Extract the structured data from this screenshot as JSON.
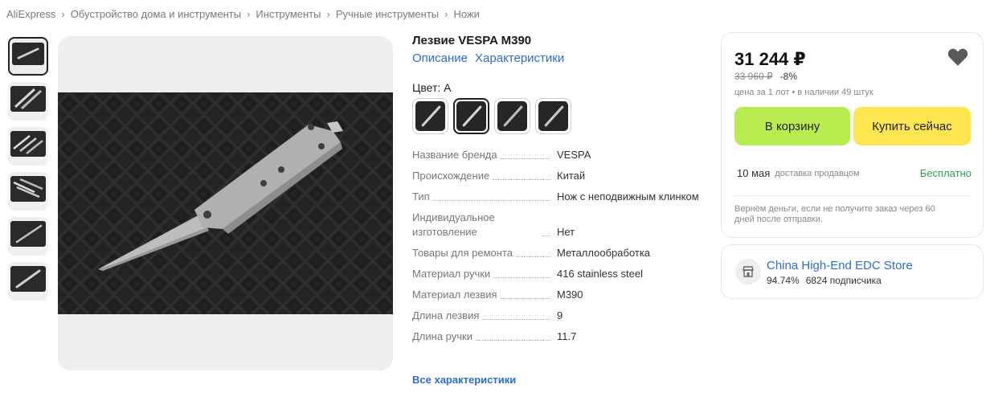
{
  "breadcrumb": [
    "AliExpress",
    "Обустройство дома и инструменты",
    "Инструменты",
    "Ручные инструменты",
    "Ножи"
  ],
  "product": {
    "title": "Лезвие VESPA M390",
    "tabs": [
      "Описание",
      "Характеристики"
    ],
    "color_label": "Цвет:",
    "color_value": "A",
    "selected_swatch_index": 1,
    "swatch_count": 4
  },
  "specs": [
    {
      "name": "Название бренда",
      "value": "VESPA"
    },
    {
      "name": "Происхождение",
      "value": "Китай"
    },
    {
      "name": "Тип",
      "value": "Нож с неподвижным клинком"
    },
    {
      "name": "Индивидуальное изготовление",
      "value": "Нет"
    },
    {
      "name": "Товары для ремонта",
      "value": "Металлообработка"
    },
    {
      "name": "Материал ручки",
      "value": "416 stainless steel"
    },
    {
      "name": "Материал лезвия",
      "value": "M390"
    },
    {
      "name": "Длина лезвия",
      "value": "9"
    },
    {
      "name": "Длина ручки",
      "value": "11.7"
    }
  ],
  "all_specs_link": "Все характеристики",
  "buy": {
    "price": "31 244 ₽",
    "old_price": "33 960 ₽",
    "discount": "-8%",
    "lot_info": "цена за 1 лот • в наличии 49 штук",
    "cart_label": "В корзину",
    "buy_now_label": "Купить сейчас",
    "delivery_date": "10 мая",
    "delivery_by": "доставка продавцом",
    "delivery_price": "Бесплатно",
    "guarantee": "Вернём деньги, если не получите заказ через 60 дней после отправки."
  },
  "store": {
    "name": "China High-End EDC Store",
    "rating": "94.74%",
    "subscribers": "6824 подписчика"
  },
  "icons": {
    "heart": "heart-icon",
    "store": "store-icon",
    "chevron": "chevron-right-icon"
  },
  "colors": {
    "link": "#2f6bd8",
    "cart_button": "#b8ec4f",
    "buy_button": "#ffe54f",
    "free_delivery": "#23a35b"
  }
}
